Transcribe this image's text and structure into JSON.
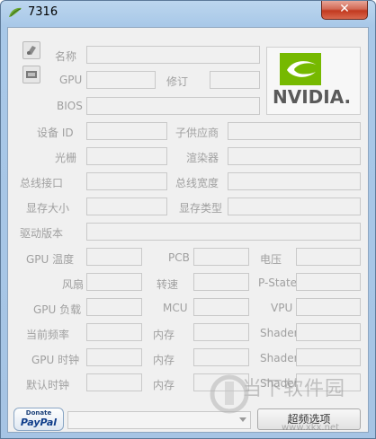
{
  "window": {
    "title": "7316",
    "close_glyph": "✕"
  },
  "logo": {
    "brand": "nvidia-logo",
    "text": "NVIDIA."
  },
  "rows": {
    "name": "名称",
    "gpu": "GPU",
    "revision": "修订",
    "bios": "BIOS",
    "device_id": "设备 ID",
    "subvendor": "子供应商",
    "rops": "光栅",
    "shaders": "渲染器",
    "bus_interface": "总线接口",
    "bus_width": "总线宽度",
    "memory_size": "显存大小",
    "memory_type": "显存类型",
    "driver_version": "驱动版本",
    "gpu_temp": "GPU 温度",
    "pcb": "PCB",
    "voltage": "电压",
    "fan": "风扇",
    "speed": "转速",
    "pstate": "P-State",
    "gpu_load": "GPU 负载",
    "mcu": "MCU",
    "vpu": "VPU",
    "current_clock": "当前频率",
    "memory1": "内存",
    "shader1": "Shader",
    "gpu_clock": "GPU 时钟",
    "memory2": "内存",
    "shader2": "Shader",
    "default_clock": "默认时钟",
    "memory3": "内存",
    "shader3": "Shader"
  },
  "bottom": {
    "paypal_donate": "Donate",
    "paypal_name": "PayPal",
    "advanced_button": "超频选项",
    "gpu_select_value": ""
  },
  "watermark": {
    "text": "当下软件园",
    "url": "www.xkx.net"
  },
  "colors": {
    "nvidia_green": "#76b900",
    "close_red": "#c2391f",
    "frame_blue": "#a8c8e8"
  }
}
